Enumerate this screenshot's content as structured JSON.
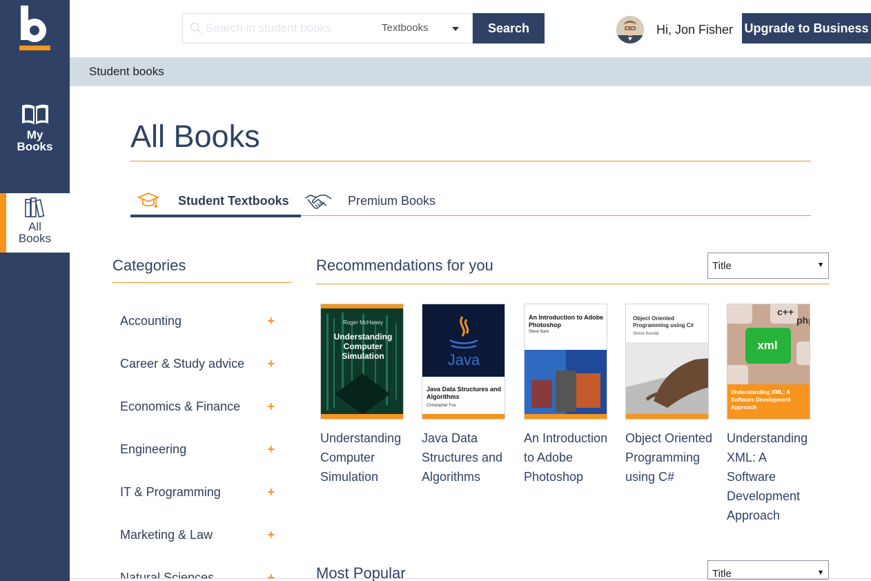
{
  "sidebar": {
    "logo_letter": "b",
    "items": [
      {
        "label_line1": "My",
        "label_line2": "Books",
        "icon": "open-book-icon"
      },
      {
        "label_line1": "All",
        "label_line2": "Books",
        "icon": "books-shelf-icon"
      }
    ]
  },
  "header": {
    "search_placeholder": "Search in student books",
    "search_scope": "Textbooks",
    "search_button": "Search",
    "greeting_prefix": "Hi,",
    "user_name": "Jon Fisher",
    "upgrade_button": "Upgrade to Business"
  },
  "breadcrumb": "Student books",
  "page": {
    "title": "All Books",
    "tabs": [
      {
        "label": "Student Textbooks",
        "icon": "graduation-cap-icon",
        "active": true
      },
      {
        "label": "Premium Books",
        "icon": "handshake-icon",
        "active": false
      }
    ]
  },
  "categories": {
    "heading": "Categories",
    "items": [
      {
        "label": "Accounting",
        "expand": "+"
      },
      {
        "label": "Career & Study advice",
        "expand": "+"
      },
      {
        "label": "Economics & Finance",
        "expand": "+"
      },
      {
        "label": "Engineering",
        "expand": "+"
      },
      {
        "label": "IT & Programming",
        "expand": "+"
      },
      {
        "label": "Marketing & Law",
        "expand": "+"
      },
      {
        "label": "Natural Sciences",
        "expand": "+"
      }
    ]
  },
  "recommendations": {
    "heading": "Recommendations for you",
    "sort": "Title",
    "books": [
      {
        "title": "Understanding Computer Simulation",
        "cover_text": "Understanding Computer Simulation",
        "cover_author": "Roger McHaney"
      },
      {
        "title": "Java Data Structures and Algorithms",
        "cover_text": "Java Data Structures and Algorithms",
        "cover_author": "Christopher Fox"
      },
      {
        "title": "An Introduction to Adobe Photoshop",
        "cover_text": "An Introduction to Adobe Photoshop",
        "cover_author": "Steve Bark"
      },
      {
        "title": "Object Oriented Programming using C#",
        "cover_text": "Object Oriented Programming using C#",
        "cover_author": "Simon Kendal"
      },
      {
        "title": "Understanding XML: A Software Development Approach",
        "cover_text": "Understanding XML: A Software Development Approach",
        "cover_author": ""
      }
    ]
  },
  "most_popular": {
    "heading": "Most Popular",
    "sort": "Title"
  },
  "colors": {
    "navy": "#2f4265",
    "accent": "#f7941d",
    "breadcrumb_bg": "#d1dbe3"
  }
}
